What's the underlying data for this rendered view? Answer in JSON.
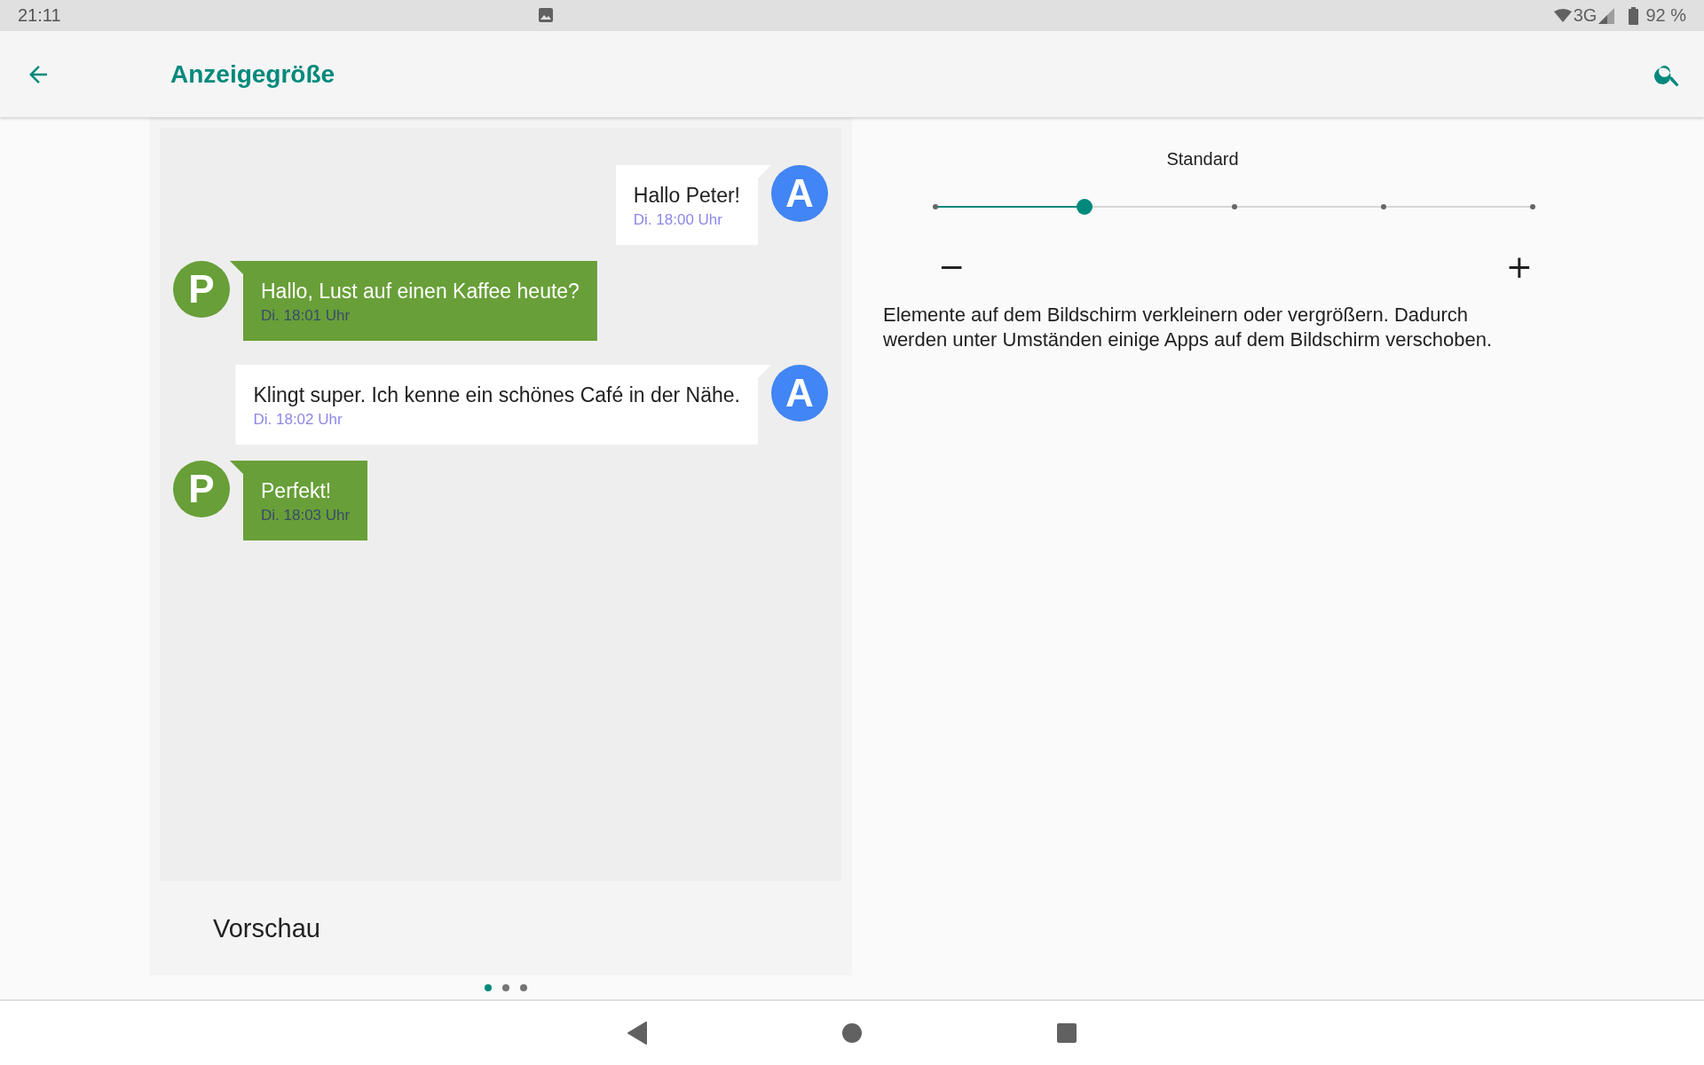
{
  "status_bar": {
    "time": "21:11",
    "network": "3G",
    "battery": "92 %"
  },
  "app_bar": {
    "title": "Anzeigegröße"
  },
  "preview": {
    "messages": [
      {
        "kind": "sent",
        "avatar": "A",
        "text": "Hallo Peter!",
        "time": "Di. 18:00 Uhr"
      },
      {
        "kind": "received",
        "avatar": "P",
        "text": "Hallo, Lust auf einen Kaffee heute?",
        "time": "Di. 18:01 Uhr"
      },
      {
        "kind": "sent",
        "avatar": "A",
        "text": "Klingt super. Ich kenne ein schönes Café in der Nähe.",
        "time": "Di. 18:02 Uhr"
      },
      {
        "kind": "received",
        "avatar": "P",
        "text": "Perfekt!",
        "time": "Di. 18:03 Uhr"
      }
    ],
    "caption": "Vorschau"
  },
  "pages": [
    {
      "selected": true
    },
    {
      "selected": false
    },
    {
      "selected": false
    }
  ],
  "size_setting": {
    "label": "Standard",
    "level": 0.25,
    "minus": "−",
    "plus": "+",
    "description": "Elemente auf dem Bildschirm verkleinern oder vergrößern. Dadurch werden unter Umständen einige Apps auf dem Bildschirm verschoben."
  }
}
